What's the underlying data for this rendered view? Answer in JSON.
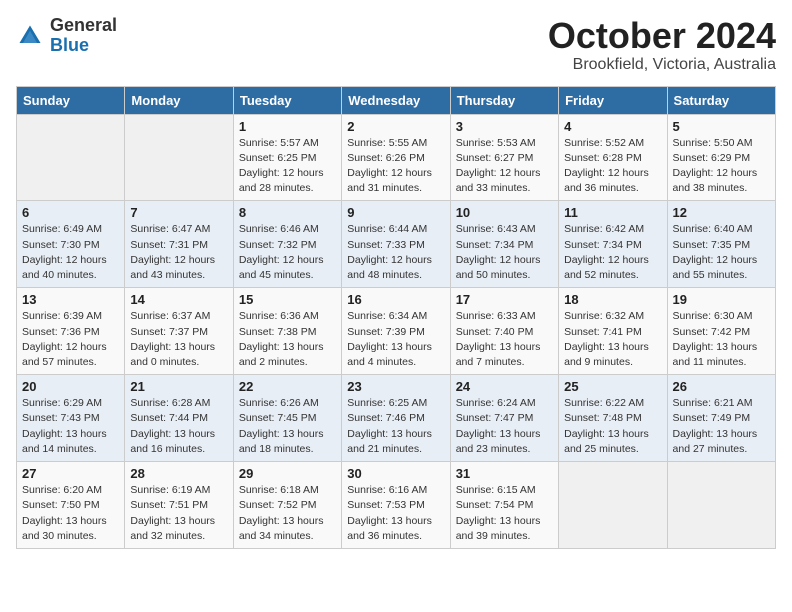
{
  "header": {
    "logo_general": "General",
    "logo_blue": "Blue",
    "month": "October 2024",
    "location": "Brookfield, Victoria, Australia"
  },
  "weekdays": [
    "Sunday",
    "Monday",
    "Tuesday",
    "Wednesday",
    "Thursday",
    "Friday",
    "Saturday"
  ],
  "weeks": [
    [
      {
        "day": "",
        "info": ""
      },
      {
        "day": "",
        "info": ""
      },
      {
        "day": "1",
        "info": "Sunrise: 5:57 AM\nSunset: 6:25 PM\nDaylight: 12 hours\nand 28 minutes."
      },
      {
        "day": "2",
        "info": "Sunrise: 5:55 AM\nSunset: 6:26 PM\nDaylight: 12 hours\nand 31 minutes."
      },
      {
        "day": "3",
        "info": "Sunrise: 5:53 AM\nSunset: 6:27 PM\nDaylight: 12 hours\nand 33 minutes."
      },
      {
        "day": "4",
        "info": "Sunrise: 5:52 AM\nSunset: 6:28 PM\nDaylight: 12 hours\nand 36 minutes."
      },
      {
        "day": "5",
        "info": "Sunrise: 5:50 AM\nSunset: 6:29 PM\nDaylight: 12 hours\nand 38 minutes."
      }
    ],
    [
      {
        "day": "6",
        "info": "Sunrise: 6:49 AM\nSunset: 7:30 PM\nDaylight: 12 hours\nand 40 minutes."
      },
      {
        "day": "7",
        "info": "Sunrise: 6:47 AM\nSunset: 7:31 PM\nDaylight: 12 hours\nand 43 minutes."
      },
      {
        "day": "8",
        "info": "Sunrise: 6:46 AM\nSunset: 7:32 PM\nDaylight: 12 hours\nand 45 minutes."
      },
      {
        "day": "9",
        "info": "Sunrise: 6:44 AM\nSunset: 7:33 PM\nDaylight: 12 hours\nand 48 minutes."
      },
      {
        "day": "10",
        "info": "Sunrise: 6:43 AM\nSunset: 7:34 PM\nDaylight: 12 hours\nand 50 minutes."
      },
      {
        "day": "11",
        "info": "Sunrise: 6:42 AM\nSunset: 7:34 PM\nDaylight: 12 hours\nand 52 minutes."
      },
      {
        "day": "12",
        "info": "Sunrise: 6:40 AM\nSunset: 7:35 PM\nDaylight: 12 hours\nand 55 minutes."
      }
    ],
    [
      {
        "day": "13",
        "info": "Sunrise: 6:39 AM\nSunset: 7:36 PM\nDaylight: 12 hours\nand 57 minutes."
      },
      {
        "day": "14",
        "info": "Sunrise: 6:37 AM\nSunset: 7:37 PM\nDaylight: 13 hours\nand 0 minutes."
      },
      {
        "day": "15",
        "info": "Sunrise: 6:36 AM\nSunset: 7:38 PM\nDaylight: 13 hours\nand 2 minutes."
      },
      {
        "day": "16",
        "info": "Sunrise: 6:34 AM\nSunset: 7:39 PM\nDaylight: 13 hours\nand 4 minutes."
      },
      {
        "day": "17",
        "info": "Sunrise: 6:33 AM\nSunset: 7:40 PM\nDaylight: 13 hours\nand 7 minutes."
      },
      {
        "day": "18",
        "info": "Sunrise: 6:32 AM\nSunset: 7:41 PM\nDaylight: 13 hours\nand 9 minutes."
      },
      {
        "day": "19",
        "info": "Sunrise: 6:30 AM\nSunset: 7:42 PM\nDaylight: 13 hours\nand 11 minutes."
      }
    ],
    [
      {
        "day": "20",
        "info": "Sunrise: 6:29 AM\nSunset: 7:43 PM\nDaylight: 13 hours\nand 14 minutes."
      },
      {
        "day": "21",
        "info": "Sunrise: 6:28 AM\nSunset: 7:44 PM\nDaylight: 13 hours\nand 16 minutes."
      },
      {
        "day": "22",
        "info": "Sunrise: 6:26 AM\nSunset: 7:45 PM\nDaylight: 13 hours\nand 18 minutes."
      },
      {
        "day": "23",
        "info": "Sunrise: 6:25 AM\nSunset: 7:46 PM\nDaylight: 13 hours\nand 21 minutes."
      },
      {
        "day": "24",
        "info": "Sunrise: 6:24 AM\nSunset: 7:47 PM\nDaylight: 13 hours\nand 23 minutes."
      },
      {
        "day": "25",
        "info": "Sunrise: 6:22 AM\nSunset: 7:48 PM\nDaylight: 13 hours\nand 25 minutes."
      },
      {
        "day": "26",
        "info": "Sunrise: 6:21 AM\nSunset: 7:49 PM\nDaylight: 13 hours\nand 27 minutes."
      }
    ],
    [
      {
        "day": "27",
        "info": "Sunrise: 6:20 AM\nSunset: 7:50 PM\nDaylight: 13 hours\nand 30 minutes."
      },
      {
        "day": "28",
        "info": "Sunrise: 6:19 AM\nSunset: 7:51 PM\nDaylight: 13 hours\nand 32 minutes."
      },
      {
        "day": "29",
        "info": "Sunrise: 6:18 AM\nSunset: 7:52 PM\nDaylight: 13 hours\nand 34 minutes."
      },
      {
        "day": "30",
        "info": "Sunrise: 6:16 AM\nSunset: 7:53 PM\nDaylight: 13 hours\nand 36 minutes."
      },
      {
        "day": "31",
        "info": "Sunrise: 6:15 AM\nSunset: 7:54 PM\nDaylight: 13 hours\nand 39 minutes."
      },
      {
        "day": "",
        "info": ""
      },
      {
        "day": "",
        "info": ""
      }
    ]
  ]
}
